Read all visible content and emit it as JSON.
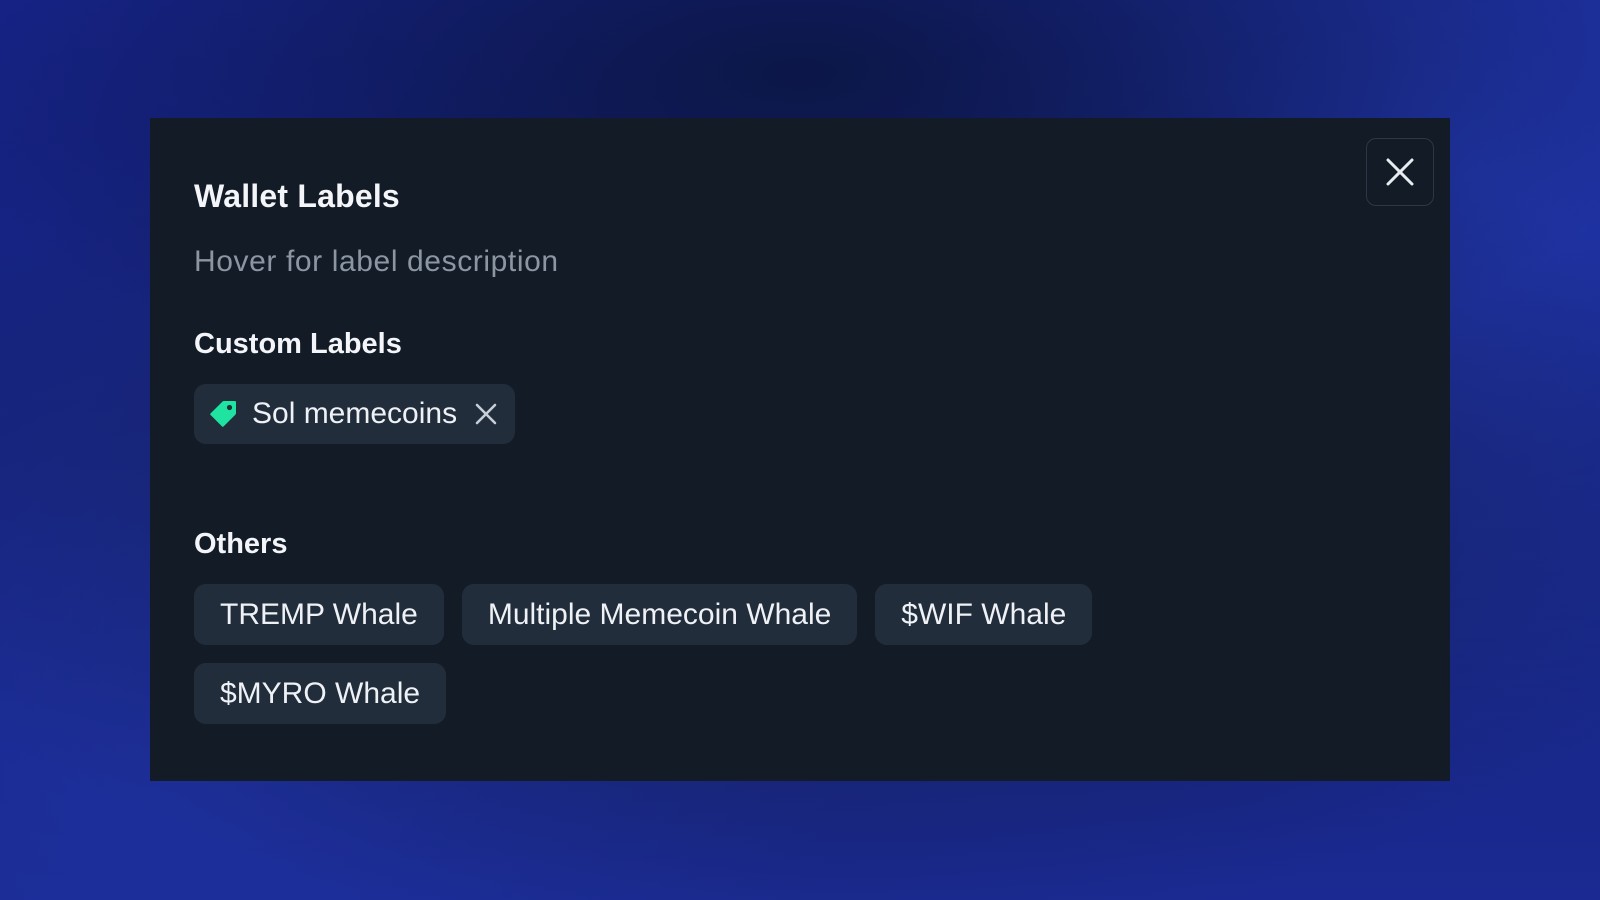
{
  "modal": {
    "title": "Wallet Labels",
    "subtitle": "Hover for label description",
    "close_icon": "close-icon"
  },
  "custom_labels": {
    "heading": "Custom Labels",
    "items": [
      {
        "label": "Sol memecoins",
        "icon": "tag-icon",
        "icon_color": "#1fe3a0",
        "remove_icon": "close-icon"
      }
    ]
  },
  "others": {
    "heading": "Others",
    "items": [
      {
        "label": "TREMP Whale"
      },
      {
        "label": "Multiple Memecoin Whale"
      },
      {
        "label": "$WIF Whale"
      },
      {
        "label": "$MYRO Whale"
      }
    ]
  },
  "colors": {
    "modal_bg": "#131c26",
    "chip_bg": "#222d3b",
    "accent_green": "#1fe3a0",
    "text_primary": "#f3f5f8",
    "text_muted": "#8c96a3"
  }
}
